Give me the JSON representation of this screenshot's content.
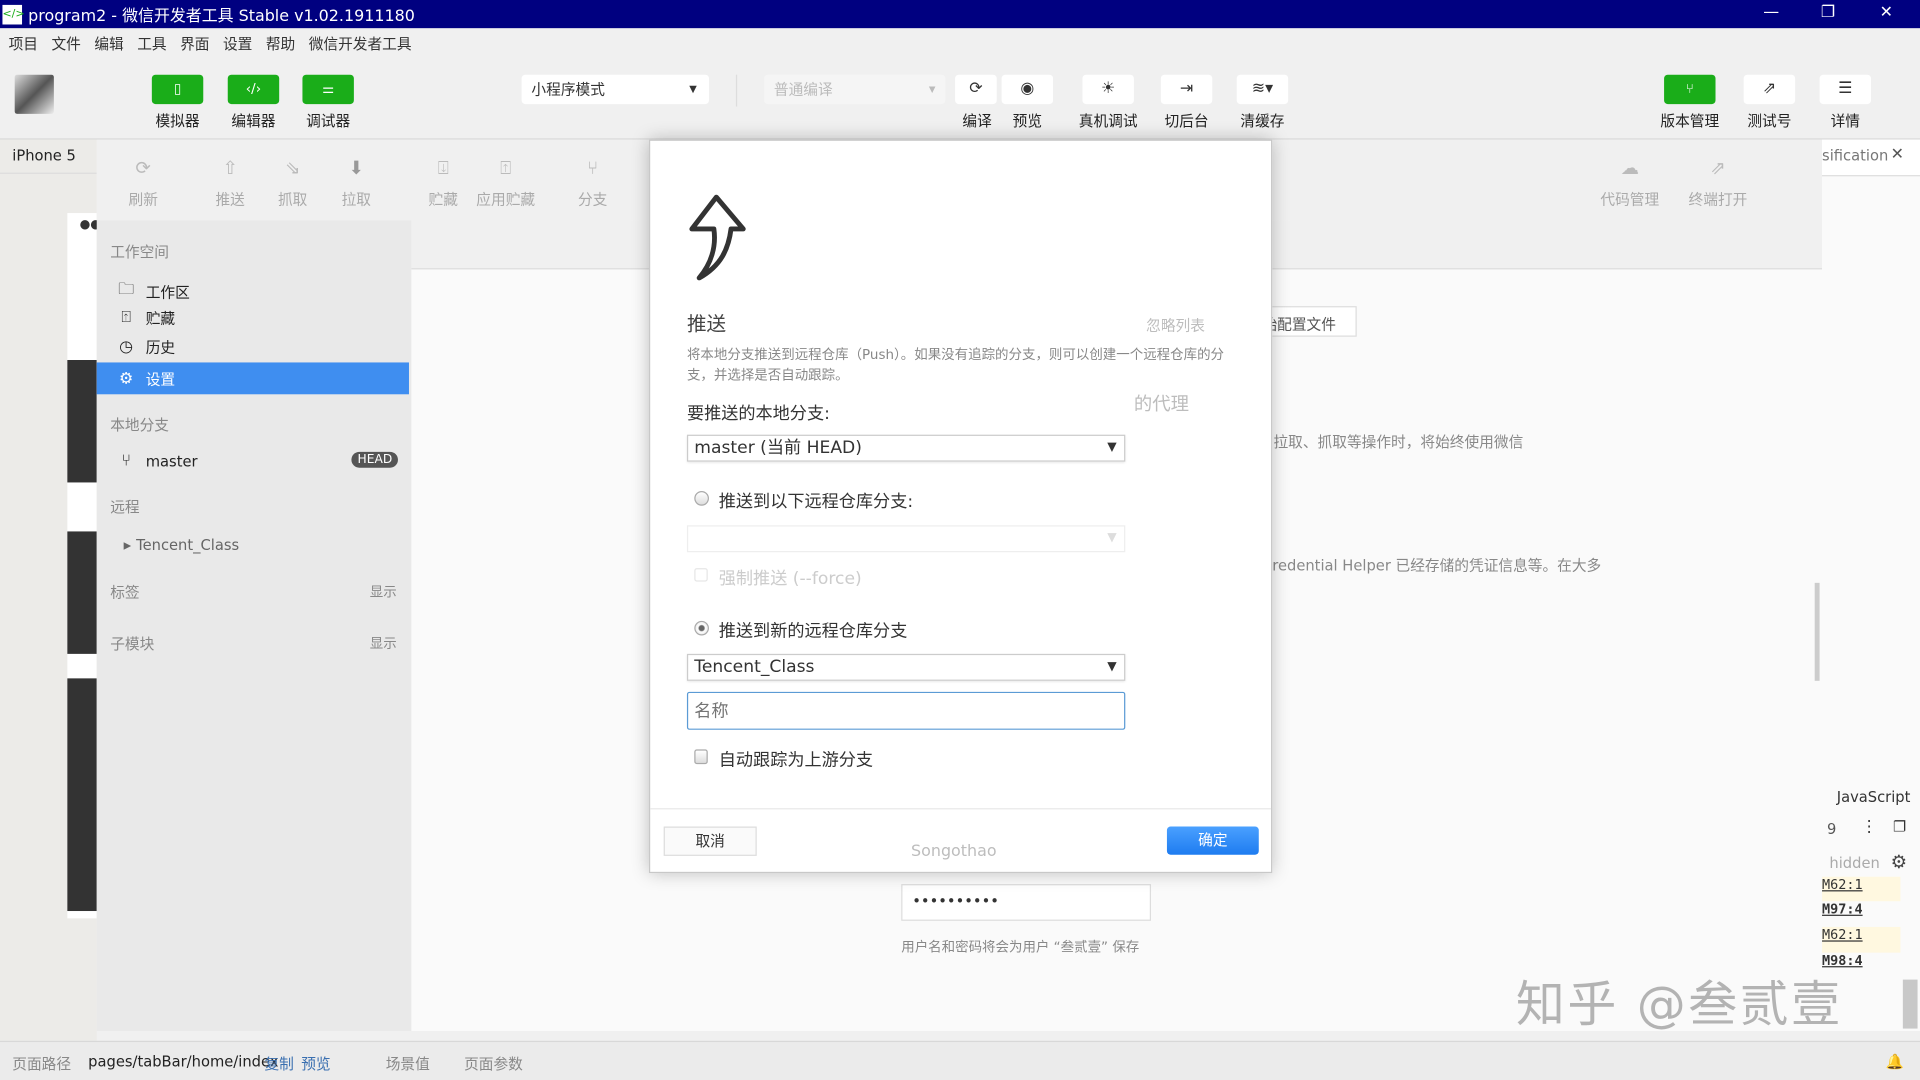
{
  "window": {
    "title": "program2 - 微信开发者工具 Stable v1.02.1911180",
    "minimize": "—",
    "maximize": "❐",
    "close": "✕"
  },
  "menu": [
    "项目",
    "文件",
    "编辑",
    "工具",
    "界面",
    "设置",
    "帮助",
    "微信开发者工具"
  ],
  "toolbar": {
    "simulator": "模拟器",
    "editor": "编辑器",
    "debugger": "调试器",
    "mode": "小程序模式",
    "compile_mode": "普通编译",
    "compile": "编译",
    "preview": "预览",
    "remote_debug": "真机调试",
    "background": "切后台",
    "clear_cache": "清缓存",
    "version": "版本管理",
    "test_account": "测试号",
    "details": "详情"
  },
  "device": "iPhone 5",
  "git_toolbar": [
    "刷新",
    "推送",
    "抓取",
    "拉取",
    "贮藏",
    "应用贮藏",
    "分支"
  ],
  "git_toolbar_right": [
    "代码管理",
    "终端打开"
  ],
  "sidebar": {
    "workspace_header": "工作空间",
    "items": [
      {
        "label": "工作区",
        "icon": "folder-icon"
      },
      {
        "label": "贮藏",
        "icon": "stash-icon"
      },
      {
        "label": "历史",
        "icon": "history-icon"
      },
      {
        "label": "设置",
        "icon": "gear-icon",
        "selected": true
      }
    ],
    "local_header": "本地分支",
    "branch": "master",
    "head_badge": "HEAD",
    "remote_header": "远程",
    "remote": "Tencent_Class",
    "tags": "标签",
    "tags_show": "显示",
    "submodules": "子模块",
    "submodules_show": "显示"
  },
  "background": {
    "ignore_list": "忽略列表",
    "config_file": "原始配置文件",
    "proxy_heading": "的代理",
    "proxy_text": "拉取、抓取等操作时，将始终使用微信",
    "cred_text": "redential Helper 已经存储的凭证信息等。在大多",
    "username": "Songothao",
    "password": "••••••••••",
    "save_note": "用户名和密码将会为用户 “叁贰壹” 保存"
  },
  "dialog": {
    "title": "推送",
    "description": "将本地分支推送到远程仓库（Push）。如果没有追踪的分支，则可以创建一个远程仓库的分支，并选择是否自动跟踪。",
    "local_label": "要推送的本地分支:",
    "local_value": "master (当前 HEAD)",
    "option_existing": "推送到以下远程仓库分支:",
    "force": "强制推送 (--force)",
    "option_new": "推送到新的远程仓库分支",
    "remote_value": "Tencent_Class",
    "name_placeholder": "名称",
    "track": "自动跟踪为上游分支",
    "cancel": "取消",
    "ok": "确定",
    "accent": "#2d8cf0"
  },
  "devtools": {
    "tab": "sification",
    "lang": "JavaScript",
    "count": "9",
    "hidden": "hidden",
    "refs": [
      "M62:1",
      "M97:4",
      "M62:1",
      "M98:4"
    ]
  },
  "statusbar": {
    "path_label": "页面路径",
    "path": "pages/tabBar/home/index",
    "copy": "复制",
    "preview": "预览",
    "scene": "场景值",
    "params": "页面参数"
  },
  "watermark": "知乎 @叁贰壹"
}
